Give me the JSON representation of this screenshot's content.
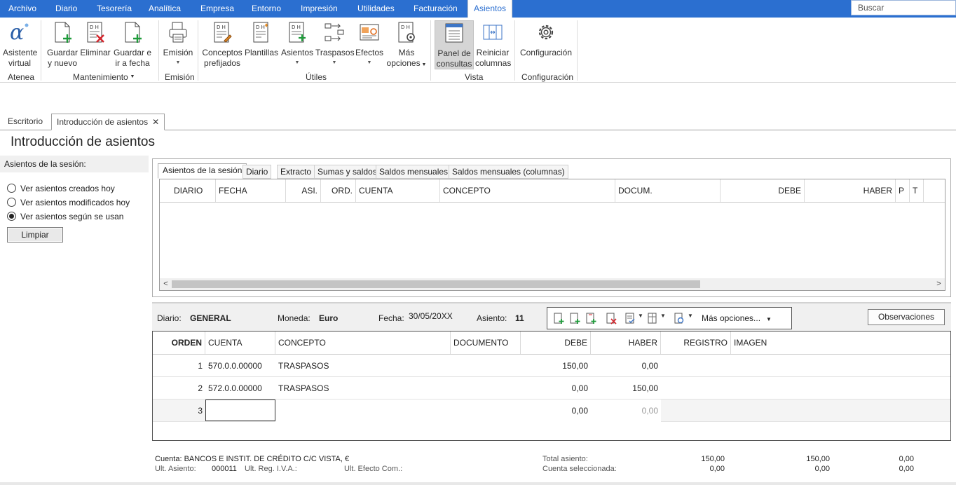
{
  "menu": {
    "tabs": [
      "Archivo",
      "Diario",
      "Tesorería",
      "Analítica",
      "Empresa",
      "Entorno",
      "Impresión",
      "Utilidades",
      "Facturación"
    ],
    "active_tab": "Asientos",
    "search_placeholder": "Buscar"
  },
  "ribbon": {
    "asistente": {
      "line1": "Asistente",
      "line2": "virtual"
    },
    "guardar_nuevo": {
      "line1": "Guardar",
      "line2": "y nuevo"
    },
    "eliminar": {
      "line1": "Eliminar"
    },
    "guardar_fecha": {
      "line1": "Guardar e",
      "line2": "ir a fecha"
    },
    "emision": {
      "line1": "Emisión"
    },
    "conceptos": {
      "line1": "Conceptos",
      "line2": "prefijados"
    },
    "plantillas": {
      "line1": "Plantillas"
    },
    "asientos": {
      "line1": "Asientos"
    },
    "traspasos": {
      "line1": "Traspasos"
    },
    "efectos": {
      "line1": "Efectos"
    },
    "mas_opciones": {
      "line1": "Más",
      "line2": "opciones"
    },
    "panel": {
      "line1": "Panel de",
      "line2": "consultas"
    },
    "reiniciar": {
      "line1": "Reiniciar",
      "line2": "columnas"
    },
    "configuracion": {
      "line1": "Configuración"
    },
    "groups": {
      "atenea": "Atenea",
      "mantenimiento": "Mantenimiento",
      "emision": "Emisión",
      "utiles": "Útiles",
      "vista": "Vista",
      "configuracion": "Configuración"
    }
  },
  "doc_tabs": {
    "escritorio": "Escritorio",
    "introduccion": "Introducción de asientos"
  },
  "page_title": "Introducción de asientos",
  "session": {
    "header": "Asientos de la sesión:",
    "options": [
      "Ver asientos creados hoy",
      "Ver asientos modificados hoy",
      "Ver asientos según se usan"
    ],
    "selected_index": 2,
    "clear_button": "Limpiar"
  },
  "subtabs": [
    "Asientos de la sesión",
    "Diario",
    "Extracto",
    "Sumas y saldos",
    "Saldos mensuales",
    "Saldos mensuales (columnas)"
  ],
  "top_grid": {
    "columns": [
      "DIARIO",
      "FECHA",
      "ASI.",
      "ORD.",
      "CUENTA",
      "CONCEPTO",
      "DOCUM.",
      "DEBE",
      "HABER",
      "P",
      "T"
    ]
  },
  "info": {
    "diario_label": "Diario:",
    "diario_value": "GENERAL",
    "moneda_label": "Moneda:",
    "moneda_value": "Euro",
    "fecha_label": "Fecha:",
    "fecha_value": "30/05/20XX",
    "asiento_label": "Asiento:",
    "asiento_value": "11",
    "mas_opciones": "Más opciones...",
    "observaciones": "Observaciones"
  },
  "entry_grid": {
    "columns": [
      "ORDEN",
      "CUENTA",
      "CONCEPTO",
      "DOCUMENTO",
      "DEBE",
      "HABER",
      "REGISTRO",
      "IMAGEN"
    ],
    "rows": [
      {
        "orden": "1",
        "cuenta": "570.0.0.00000",
        "concepto": "TRASPASOS",
        "documento": "",
        "debe": "150,00",
        "haber": "0,00"
      },
      {
        "orden": "2",
        "cuenta": "572.0.0.00000",
        "concepto": "TRASPASOS",
        "documento": "",
        "debe": "0,00",
        "haber": "150,00"
      },
      {
        "orden": "3",
        "cuenta": "",
        "concepto": "",
        "documento": "",
        "debe": "0,00",
        "haber": "0,00"
      }
    ]
  },
  "footer": {
    "cuenta": "Cuenta: BANCOS E INSTIT. DE CRÉDITO C/C VISTA, €",
    "ult_asiento_label": "Ult. Asiento:",
    "ult_asiento_value": "000011",
    "ult_reg_iva_label": "Ult. Reg. I.V.A.:",
    "ult_efecto_label": "Ult. Efecto Com.:",
    "total_label": "Total asiento:",
    "cuenta_sel_label": "Cuenta seleccionada:",
    "total_values": [
      "150,00",
      "150,00",
      "0,00"
    ],
    "sel_values": [
      "0,00",
      "0,00",
      "0,00"
    ]
  }
}
